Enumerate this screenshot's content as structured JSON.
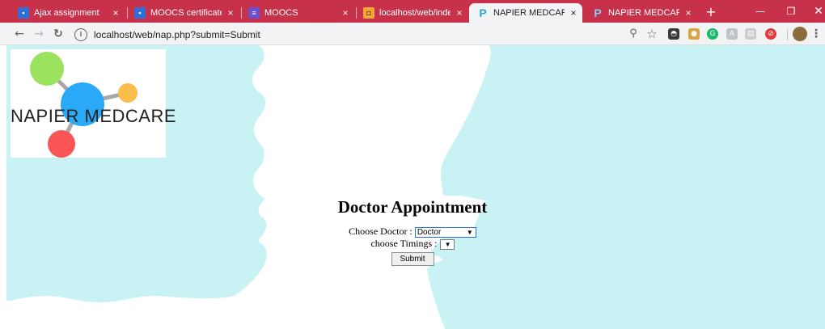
{
  "browser": {
    "tabs": [
      {
        "title": "Ajax assignment",
        "favicon": "doc-icon",
        "active": false
      },
      {
        "title": "MOOCS certificate",
        "favicon": "doc-icon",
        "active": false
      },
      {
        "title": "MOOCS",
        "favicon": "list-icon",
        "active": false
      },
      {
        "title": "localhost/web/index.ph",
        "favicon": "web-icon",
        "active": false
      },
      {
        "title": "NAPIER MEDCARE",
        "favicon": "p-icon",
        "active": true
      },
      {
        "title": "NAPIER MEDCARE",
        "favicon": "p-icon",
        "active": false
      }
    ],
    "tab_close_glyph": "×",
    "new_tab_glyph": "+",
    "url": "localhost/web/nap.php?submit=Submit",
    "colors": {
      "tabstrip": "#c8314a",
      "toolbar": "#f1f3f4"
    }
  },
  "page": {
    "logo": {
      "text": "NAPIER MEDCARE",
      "colors": {
        "green": "#9be35f",
        "blue": "#29a9f7",
        "orange": "#fbbe4a",
        "red": "#fb5558",
        "stem": "#a8a8a8"
      }
    },
    "heading": "Doctor Appointment",
    "doctor_label": "Choose Doctor :",
    "doctor_selected": "Doctor",
    "timings_label": "choose Timings :",
    "timings_selected": "",
    "submit_label": "Submit",
    "background_color": "#c9f2f5"
  }
}
